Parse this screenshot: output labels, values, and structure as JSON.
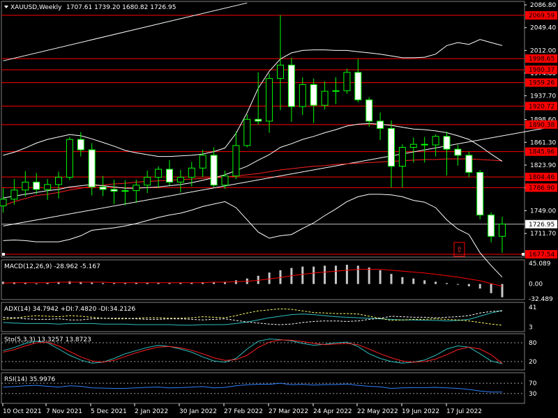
{
  "header": {
    "symbol_label": "XAUUSD,Weekly",
    "ohlc_label": "1707.61 1739.20 1680.82 1726.95"
  },
  "colors": {
    "background": "#000000",
    "bull": "#00ff00",
    "bear_fill": "#ffffff",
    "hline": "#ff0000",
    "price_tag": "#ff0000",
    "current_tag": "#ffffff",
    "ma_red": "#ff2020",
    "band": "#ffffff",
    "macd_signal": "#ff0000",
    "adx": "#ffffff",
    "diplus": "#ffff66",
    "diminus": "#ffffff",
    "stoch_main": "#30c0c0",
    "stoch_signal": "#ff2020",
    "rsi": "#3080ff",
    "level_dot": "#ffffff"
  },
  "chart_data": [
    {
      "type": "candlestick",
      "panel": "price",
      "ylim": [
        1677.54,
        2086.8
      ],
      "y_ticks": [
        "2086.80",
        "2049.40",
        "2012.00",
        "1974.80",
        "1937.70",
        "1898.60",
        "1861.30",
        "1823.90",
        "1786.90",
        "1749.00",
        "1711.70"
      ],
      "price_levels": [
        "2069.59",
        "1998.65",
        "1980.37",
        "1959.26",
        "1920.72",
        "1890.38",
        "1845.96",
        "1804.46",
        "1786.90",
        "1677.54"
      ],
      "current_price_label": "1726.95",
      "x_labels": [
        "10 Oct 2021",
        "7 Nov 2021",
        "5 Dec 2021",
        "2 Jan 2022",
        "30 Jan 2022",
        "27 Feb 2022",
        "27 Mar 2022",
        "24 Apr 2022",
        "22 May 2022",
        "19 Jun 2022",
        "17 Jul 2022"
      ],
      "candles": [
        {
          "o": 1757,
          "h": 1786,
          "l": 1746,
          "c": 1768
        },
        {
          "o": 1768,
          "h": 1801,
          "l": 1759,
          "c": 1783
        },
        {
          "o": 1783,
          "h": 1814,
          "l": 1772,
          "c": 1796
        },
        {
          "o": 1796,
          "h": 1811,
          "l": 1776,
          "c": 1784
        },
        {
          "o": 1784,
          "h": 1801,
          "l": 1767,
          "c": 1792
        },
        {
          "o": 1792,
          "h": 1813,
          "l": 1769,
          "c": 1804
        },
        {
          "o": 1804,
          "h": 1870,
          "l": 1799,
          "c": 1866
        },
        {
          "o": 1866,
          "h": 1878,
          "l": 1838,
          "c": 1849
        },
        {
          "o": 1849,
          "h": 1860,
          "l": 1774,
          "c": 1788
        },
        {
          "o": 1788,
          "h": 1806,
          "l": 1773,
          "c": 1784
        },
        {
          "o": 1784,
          "h": 1800,
          "l": 1760,
          "c": 1781
        },
        {
          "o": 1781,
          "h": 1799,
          "l": 1758,
          "c": 1782
        },
        {
          "o": 1782,
          "h": 1800,
          "l": 1762,
          "c": 1791
        },
        {
          "o": 1791,
          "h": 1815,
          "l": 1778,
          "c": 1804
        },
        {
          "o": 1804,
          "h": 1822,
          "l": 1786,
          "c": 1817
        },
        {
          "o": 1817,
          "h": 1832,
          "l": 1790,
          "c": 1796
        },
        {
          "o": 1796,
          "h": 1816,
          "l": 1779,
          "c": 1804
        },
        {
          "o": 1804,
          "h": 1829,
          "l": 1789,
          "c": 1819
        },
        {
          "o": 1819,
          "h": 1849,
          "l": 1804,
          "c": 1840
        },
        {
          "o": 1840,
          "h": 1853,
          "l": 1788,
          "c": 1791
        },
        {
          "o": 1791,
          "h": 1815,
          "l": 1785,
          "c": 1806
        },
        {
          "o": 1806,
          "h": 1879,
          "l": 1801,
          "c": 1856
        },
        {
          "o": 1856,
          "h": 1907,
          "l": 1853,
          "c": 1899
        },
        {
          "o": 1899,
          "h": 1976,
          "l": 1890,
          "c": 1896
        },
        {
          "o": 1896,
          "h": 1974,
          "l": 1877,
          "c": 1966
        },
        {
          "o": 1966,
          "h": 2070,
          "l": 1914,
          "c": 1988
        },
        {
          "o": 1988,
          "h": 2000,
          "l": 1895,
          "c": 1920
        },
        {
          "o": 1920,
          "h": 1968,
          "l": 1906,
          "c": 1956
        },
        {
          "o": 1956,
          "h": 1966,
          "l": 1893,
          "c": 1922
        },
        {
          "o": 1922,
          "h": 1961,
          "l": 1915,
          "c": 1945
        },
        {
          "o": 1945,
          "h": 1968,
          "l": 1924,
          "c": 1946
        },
        {
          "o": 1946,
          "h": 1982,
          "l": 1941,
          "c": 1976
        },
        {
          "o": 1976,
          "h": 1998,
          "l": 1927,
          "c": 1931
        },
        {
          "o": 1931,
          "h": 1935,
          "l": 1887,
          "c": 1896
        },
        {
          "o": 1896,
          "h": 1910,
          "l": 1865,
          "c": 1884
        },
        {
          "o": 1884,
          "h": 1897,
          "l": 1787,
          "c": 1822
        },
        {
          "o": 1822,
          "h": 1858,
          "l": 1787,
          "c": 1853
        },
        {
          "o": 1853,
          "h": 1869,
          "l": 1828,
          "c": 1858
        },
        {
          "o": 1858,
          "h": 1870,
          "l": 1828,
          "c": 1857
        },
        {
          "o": 1857,
          "h": 1874,
          "l": 1838,
          "c": 1871
        },
        {
          "o": 1871,
          "h": 1879,
          "l": 1807,
          "c": 1850
        },
        {
          "o": 1850,
          "h": 1857,
          "l": 1823,
          "c": 1840
        },
        {
          "o": 1840,
          "h": 1846,
          "l": 1804,
          "c": 1812
        },
        {
          "o": 1812,
          "h": 1816,
          "l": 1735,
          "c": 1742
        },
        {
          "o": 1742,
          "h": 1746,
          "l": 1697,
          "c": 1707
        },
        {
          "o": 1707,
          "h": 1739,
          "l": 1680,
          "c": 1727
        }
      ],
      "overlays": [
        {
          "name": "red-ma",
          "values": [
            1757,
            1764,
            1769,
            1774,
            1776,
            1779,
            1783,
            1786,
            1789,
            1791,
            1793,
            1794,
            1796,
            1797,
            1798,
            1799,
            1800,
            1801,
            1802,
            1803,
            1804,
            1806,
            1808,
            1810,
            1813,
            1816,
            1818,
            1820,
            1822,
            1823,
            1825,
            1826,
            1827,
            1828,
            1829,
            1830,
            1831,
            1832,
            1833,
            1833,
            1834,
            1834,
            1834,
            1833,
            1832,
            1831
          ]
        },
        {
          "name": "band-mid",
          "values": [
            1770,
            1773,
            1776,
            1779,
            1782,
            1784,
            1788,
            1790,
            1792,
            1790,
            1788,
            1786,
            1786,
            1787,
            1788,
            1790,
            1792,
            1795,
            1799,
            1803,
            1808,
            1815,
            1822,
            1832,
            1841,
            1853,
            1859,
            1866,
            1871,
            1877,
            1882,
            1888,
            1891,
            1892,
            1891,
            1889,
            1886,
            1883,
            1882,
            1880,
            1877,
            1872,
            1866,
            1855,
            1842,
            1830
          ]
        },
        {
          "name": "band-upper",
          "values": [
            1840,
            1845,
            1852,
            1860,
            1866,
            1870,
            1874,
            1872,
            1867,
            1861,
            1855,
            1848,
            1844,
            1841,
            1838,
            1838,
            1839,
            1840,
            1842,
            1846,
            1852,
            1876,
            1910,
            1950,
            1978,
            1998,
            2008,
            2012,
            2013,
            2013,
            2012,
            2012,
            2010,
            2008,
            2006,
            2003,
            2000,
            2000,
            2001,
            2006,
            2020,
            2025,
            2022,
            2030,
            2025,
            2020
          ]
        },
        {
          "name": "band-lower",
          "values": [
            1700,
            1701,
            1700,
            1698,
            1698,
            1698,
            1702,
            1708,
            1717,
            1719,
            1721,
            1724,
            1728,
            1733,
            1738,
            1742,
            1745,
            1750,
            1756,
            1760,
            1764,
            1754,
            1734,
            1714,
            1704,
            1708,
            1710,
            1720,
            1729,
            1741,
            1752,
            1764,
            1772,
            1776,
            1776,
            1775,
            1772,
            1766,
            1763,
            1754,
            1734,
            1719,
            1710,
            1680,
            1659,
            1640
          ]
        }
      ],
      "trendlines": [
        {
          "name": "upper-channel",
          "from": {
            "i": 0,
            "v": 1995
          },
          "to": {
            "i": 22,
            "v": 2090
          }
        },
        {
          "name": "lower-channel",
          "from": {
            "i": 0,
            "v": 1724
          },
          "to": {
            "i": 49,
            "v": 1885
          }
        }
      ]
    },
    {
      "type": "bar",
      "panel": "macd",
      "label": "MACD(12,26,9) -28.962 -5.167",
      "ylim": [
        -32.489,
        45.089
      ],
      "y_ticks": [
        "45.089",
        "0.00",
        "-32.489"
      ],
      "histogram": [
        5,
        4,
        3,
        1,
        3,
        4,
        6,
        5,
        3,
        2,
        2,
        2,
        3,
        3,
        3,
        2,
        3,
        3,
        4,
        4,
        5,
        8,
        12,
        18,
        25,
        30,
        35,
        38,
        38,
        40,
        40,
        42,
        40,
        36,
        30,
        22,
        15,
        12,
        8,
        5,
        2,
        0,
        -5,
        -10,
        -20,
        -29
      ],
      "signal": [
        2,
        3,
        3,
        3,
        3,
        4,
        4,
        4,
        4,
        4,
        3,
        3,
        3,
        3,
        3,
        3,
        3,
        3,
        3,
        4,
        4,
        5,
        6,
        8,
        11,
        14,
        18,
        21,
        24,
        26,
        28,
        30,
        32,
        32,
        32,
        30,
        28,
        26,
        24,
        21,
        18,
        15,
        11,
        7,
        1,
        -5
      ]
    },
    {
      "type": "line",
      "panel": "adx",
      "label": "ADX(14) 34.7942 +DI:7.4820 -DI:34.2126",
      "ylim": [
        0,
        45
      ],
      "y_ticks": [
        "41",
        "3"
      ],
      "adx": [
        12,
        11,
        10,
        10,
        10,
        9,
        10,
        10,
        10,
        9,
        9,
        9,
        8,
        8,
        8,
        8,
        7,
        7,
        8,
        8,
        8,
        10,
        13,
        17,
        21,
        24,
        27,
        28,
        27,
        25,
        23,
        22,
        21,
        20,
        19,
        18,
        17,
        17,
        16,
        16,
        15,
        16,
        18,
        24,
        30,
        35
      ],
      "di_plus": [
        18,
        20,
        23,
        25,
        24,
        23,
        25,
        24,
        22,
        20,
        19,
        19,
        20,
        21,
        21,
        20,
        20,
        21,
        23,
        22,
        21,
        25,
        30,
        34,
        36,
        38,
        37,
        34,
        31,
        30,
        29,
        29,
        28,
        24,
        20,
        16,
        17,
        18,
        18,
        19,
        18,
        17,
        15,
        12,
        9,
        7
      ],
      "di_minus": [
        22,
        21,
        19,
        18,
        18,
        19,
        17,
        17,
        19,
        20,
        20,
        20,
        19,
        18,
        18,
        19,
        19,
        18,
        17,
        18,
        19,
        16,
        13,
        11,
        9,
        8,
        9,
        12,
        14,
        15,
        15,
        14,
        15,
        18,
        20,
        24,
        23,
        22,
        22,
        21,
        22,
        23,
        25,
        30,
        33,
        34
      ]
    },
    {
      "type": "line",
      "panel": "stochastic",
      "label": "Sto(5,3,3) 13.3257 13.8723",
      "ylim": [
        0,
        100
      ],
      "y_ticks": [
        "80",
        "20"
      ],
      "levels": [
        80,
        20
      ],
      "main": [
        55,
        65,
        78,
        85,
        80,
        60,
        40,
        25,
        15,
        18,
        30,
        45,
        55,
        65,
        72,
        68,
        60,
        50,
        35,
        22,
        18,
        30,
        60,
        85,
        92,
        90,
        86,
        78,
        72,
        75,
        80,
        82,
        68,
        45,
        30,
        20,
        15,
        18,
        25,
        40,
        60,
        70,
        66,
        45,
        22,
        13
      ],
      "signal": [
        50,
        58,
        70,
        80,
        82,
        70,
        52,
        35,
        22,
        18,
        24,
        36,
        48,
        58,
        66,
        68,
        64,
        56,
        45,
        32,
        24,
        26,
        40,
        65,
        82,
        89,
        88,
        84,
        78,
        74,
        76,
        78,
        74,
        60,
        45,
        32,
        22,
        18,
        20,
        28,
        42,
        58,
        66,
        60,
        42,
        14
      ]
    },
    {
      "type": "line",
      "panel": "rsi",
      "label": "RSI(14) 35.9976",
      "ylim": [
        0,
        100
      ],
      "y_ticks": [
        "70",
        "30"
      ],
      "levels": [
        70,
        30
      ],
      "rsi": [
        55,
        57,
        60,
        62,
        58,
        55,
        60,
        58,
        52,
        51,
        50,
        50,
        52,
        54,
        55,
        52,
        53,
        55,
        57,
        52,
        54,
        60,
        64,
        66,
        66,
        70,
        64,
        66,
        63,
        65,
        65,
        67,
        62,
        58,
        56,
        50,
        52,
        53,
        53,
        54,
        52,
        50,
        46,
        40,
        36,
        36
      ]
    }
  ]
}
